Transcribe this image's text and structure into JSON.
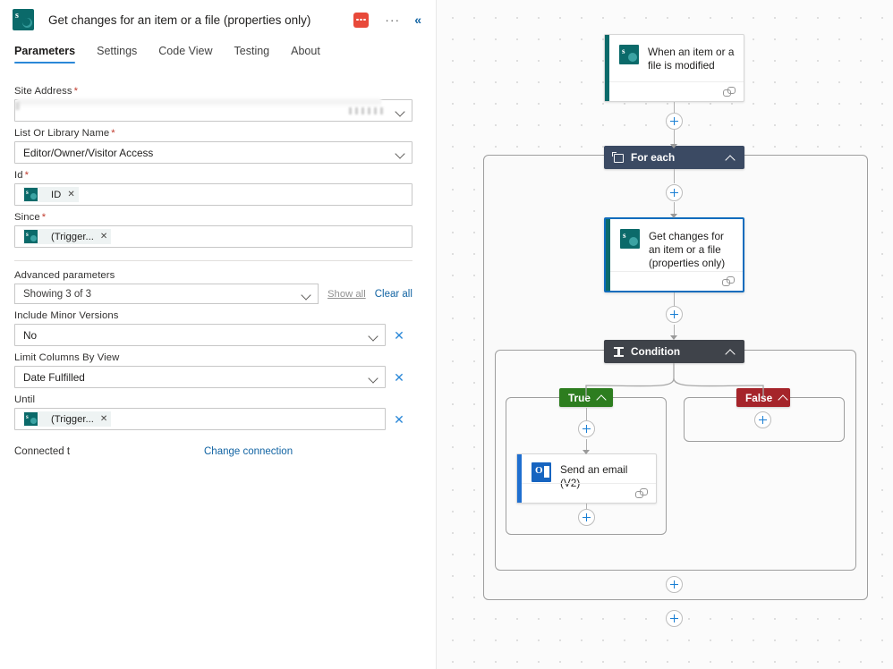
{
  "panel": {
    "title": "Get changes for an item or a file (properties only)",
    "icon": "sharepoint-icon",
    "error_badge": "error-badge",
    "more_button": "···",
    "collapse_button": "«",
    "tabs": [
      {
        "label": "Parameters",
        "active": true
      },
      {
        "label": "Settings",
        "active": false
      },
      {
        "label": "Code View",
        "active": false
      },
      {
        "label": "Testing",
        "active": false
      },
      {
        "label": "About",
        "active": false
      }
    ],
    "fields": [
      {
        "label": "Site Address",
        "required": true,
        "value": "",
        "type": "combobox-redacted"
      },
      {
        "label": "List Or Library Name",
        "required": true,
        "value": "Editor/Owner/Visitor Access",
        "type": "combobox"
      },
      {
        "label": "Id",
        "required": true,
        "value": "ID",
        "type": "token"
      },
      {
        "label": "Since",
        "required": true,
        "value": "(Trigger...",
        "type": "token"
      }
    ],
    "advanced": {
      "label": "Advanced parameters",
      "selected": "Showing 3 of 3",
      "show_all": "Show all",
      "clear_all": "Clear all",
      "fields": [
        {
          "label": "Include Minor Versions",
          "value": "No",
          "type": "combobox"
        },
        {
          "label": "Limit Columns By View",
          "value": "Date Fulfilled",
          "type": "combobox"
        },
        {
          "label": "Until",
          "value": "(Trigger...",
          "type": "token"
        }
      ]
    },
    "connection": {
      "status": "Connected t",
      "change_link": "Change connection"
    }
  },
  "flow": {
    "trigger": {
      "label": "When an item or a file is modified",
      "icon": "sharepoint-icon",
      "accent": "#0b6a6a"
    },
    "foreach": {
      "label": "For each",
      "icon": "loop-icon",
      "color": "#3b4a63"
    },
    "action": {
      "label": "Get changes for an item or a file (properties only)",
      "icon": "sharepoint-icon",
      "accent": "#0b6a6a",
      "selected": true
    },
    "condition": {
      "label": "Condition",
      "icon": "condition-icon",
      "color": "#3f434a",
      "branches": [
        {
          "label": "True",
          "color": "#2d7d1f"
        },
        {
          "label": "False",
          "color": "#a5242a"
        }
      ]
    },
    "email": {
      "label": "Send an email (V2)",
      "icon": "outlook-icon",
      "accent": "#1664c0"
    },
    "add_button": "+"
  }
}
